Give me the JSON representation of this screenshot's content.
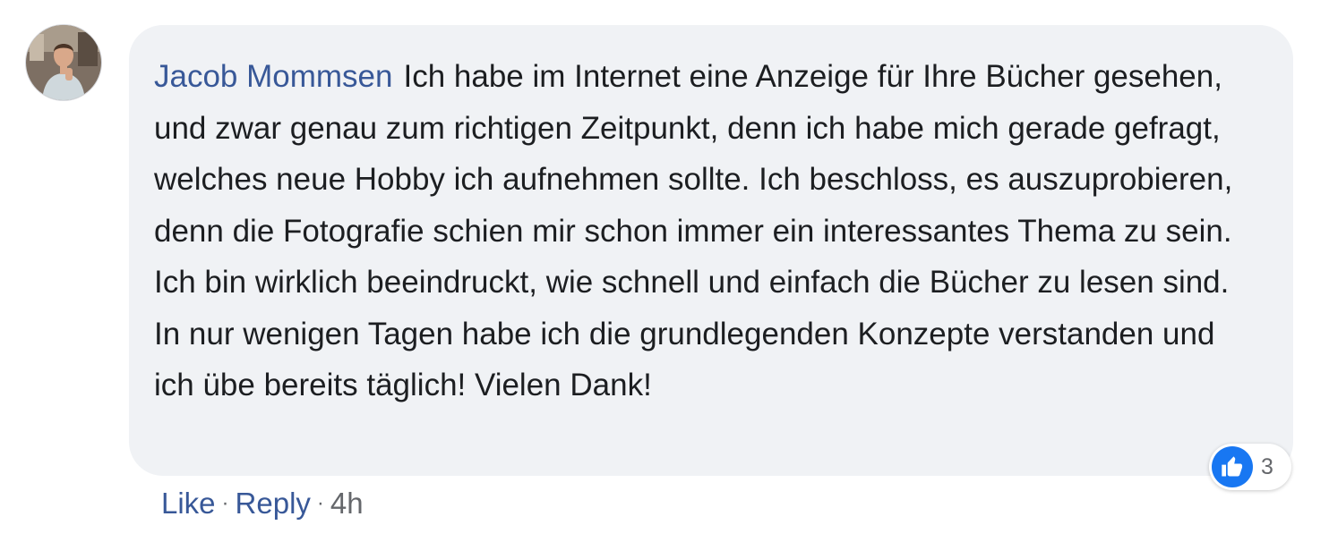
{
  "comment": {
    "author": "Jacob Mommsen",
    "text": "Ich habe im Internet eine Anzeige für Ihre Bücher gesehen, und zwar genau zum richtigen Zeitpunkt, denn ich habe mich gerade gefragt, welches neue Hobby ich aufnehmen sollte. Ich beschloss, es auszuprobieren, denn die Fotografie schien mir schon immer ein interessantes Thema zu sein. Ich bin wirklich beeindruckt, wie schnell und einfach die Bücher zu lesen sind. In nur wenigen Tagen habe ich die grundlegenden Konzepte verstanden und ich übe bereits täglich! Vielen Dank!",
    "reactions": {
      "icon": "thumbs-up-icon",
      "count": "3"
    },
    "actions": {
      "like_label": "Like",
      "reply_label": "Reply",
      "separator": "·",
      "timestamp": "4h"
    }
  },
  "colors": {
    "author_link": "#385898",
    "bubble_bg": "#f0f2f5",
    "like_blue": "#1877f2",
    "meta_gray": "#65676b"
  }
}
